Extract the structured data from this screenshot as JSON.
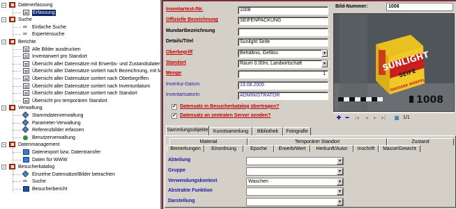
{
  "tree": {
    "nodes": [
      {
        "label": "Datenerfassung",
        "level": 0,
        "toggle": "−",
        "icon": "folder"
      },
      {
        "label": "Erfassung",
        "level": 1,
        "icon": "page",
        "selected": true
      },
      {
        "label": "Suche",
        "level": 0,
        "toggle": "−",
        "icon": "folder"
      },
      {
        "label": "Einfache Suche",
        "level": 1,
        "icon": "bino"
      },
      {
        "label": "Expertensuche",
        "level": 1,
        "icon": "bino"
      },
      {
        "label": "Berichte",
        "level": 0,
        "toggle": "−",
        "icon": "folder"
      },
      {
        "label": "Alle Bilder ausdrucken",
        "level": 1,
        "icon": "page"
      },
      {
        "label": "Inventarwert pro Standort",
        "level": 1,
        "icon": "page"
      },
      {
        "label": "Übersicht aller Datensätze mit Erwerbs- und Zustandsdaten",
        "level": 1,
        "icon": "page"
      },
      {
        "label": "Übersicht aller Datensätze sortiert nach Bezeichnung, mit M",
        "level": 1,
        "icon": "page"
      },
      {
        "label": "Übersicht aller Datensätze sortiert nach Oberbegriffen",
        "level": 1,
        "icon": "page"
      },
      {
        "label": "Übersicht aller Datensätze sortiert nach Inventurdatum",
        "level": 1,
        "icon": "page"
      },
      {
        "label": "Übersicht aller Datensätze sortiert nach Standort",
        "level": 1,
        "icon": "page"
      },
      {
        "label": "Übersicht pro temporären Standort",
        "level": 1,
        "icon": "page"
      },
      {
        "label": "Verwaltung",
        "level": 0,
        "toggle": "−",
        "icon": "folder"
      },
      {
        "label": "Stammdatenverwaltung",
        "level": 1,
        "icon": "tool"
      },
      {
        "label": "Parameter-Verwaltung",
        "level": 1,
        "icon": "tool"
      },
      {
        "label": "Referenzbilder erfassen",
        "level": 1,
        "icon": "tool"
      },
      {
        "label": "Benutzerverwaltung",
        "level": 1,
        "icon": "person"
      },
      {
        "label": "Datenmanagement",
        "level": 0,
        "toggle": "−",
        "icon": "folder"
      },
      {
        "label": "Datenexport bzw. Datentransfer",
        "level": 1,
        "icon": "cube"
      },
      {
        "label": "Daten für WWW",
        "level": 1,
        "icon": "cube"
      },
      {
        "label": "Besucherkatalog",
        "level": 0,
        "toggle": "−",
        "icon": "folder"
      },
      {
        "label": "Einzelne Datensätze/Bilder betrachten",
        "level": 1,
        "icon": "tool"
      },
      {
        "label": "Suche",
        "level": 1,
        "icon": "bino"
      },
      {
        "label": "Besucherbericht",
        "level": 1,
        "icon": "book"
      }
    ]
  },
  "form": {
    "fields": [
      {
        "label": "Inventartext-/Nr.",
        "style": "red",
        "value": "1008",
        "dropdown": false
      },
      {
        "label": "Offizielle Bezeichnung",
        "style": "red",
        "value": "SEIFENPACKUNG",
        "dropdown": false
      },
      {
        "label": "Mundartbezeichnung",
        "style": "plain",
        "value": "",
        "dropdown": false
      },
      {
        "label": "Details/Titel",
        "style": "plain",
        "value": "Sunlight Seife",
        "dropdown": false
      },
      {
        "label": "Oberbegriff",
        "style": "red",
        "value": "Behältnis, Gefäss",
        "dropdown": true
      },
      {
        "label": "Standort",
        "style": "red",
        "value": "Raum 0.00m, Landwirtschaft",
        "dropdown": true
      },
      {
        "label": "Menge",
        "style": "red",
        "value": "1",
        "dropdown": false,
        "numeric": true
      },
      {
        "label": "Inventur-Datum",
        "style": "blue",
        "value": "19.08.2005",
        "dropdown": false,
        "blueval": true
      },
      {
        "label": "InventarisatorIn",
        "style": "blue",
        "value": "ADMINISTRATOR",
        "dropdown": false,
        "blueval": true
      }
    ],
    "checkboxes": [
      {
        "label": "Datensatz in Besucherkatalog übertragen?",
        "checked": true
      },
      {
        "label": "Datensatz an zentralen Server senden?",
        "checked": true
      }
    ]
  },
  "image": {
    "label": "Bild-Nummer:",
    "number": "1008",
    "photo_caption": "1008",
    "brand": "SUNLIGHT",
    "brand_sub": "SEIFE",
    "box_text": "GROSSER WÜRFEL",
    "counter": "1/1"
  },
  "tabs": {
    "top": [
      "Sammlungsobjekte",
      "Kunstsammlung",
      "Bibliothek",
      "Fotografie"
    ],
    "active_top": 0,
    "group_row": [
      "Material",
      "Temporärer Standort",
      "Zustand"
    ],
    "sub_row": [
      "Bemerkungen",
      "Einordnung",
      "Epoche",
      "Erwerb/Wert",
      "Herkunft/Autor",
      "Inschrift",
      "Masse/Gewicht"
    ],
    "active_sub": 1
  },
  "einordnung": {
    "rows": [
      {
        "label": "Abteilung",
        "value": ""
      },
      {
        "label": "Gruppe",
        "value": ""
      },
      {
        "label": "Verwendungskontext",
        "value": "Waschen"
      },
      {
        "label": "Abstrakte Funktion",
        "value": ""
      },
      {
        "label": "Darstellung",
        "value": ""
      }
    ]
  },
  "colors": {
    "selection": "#0a246a",
    "required_label": "#c00000",
    "info_label": "#1a1aa0",
    "border_accent": "#7a2a3a",
    "box_yellow": "#e8c020",
    "box_red": "#c81e1e"
  }
}
